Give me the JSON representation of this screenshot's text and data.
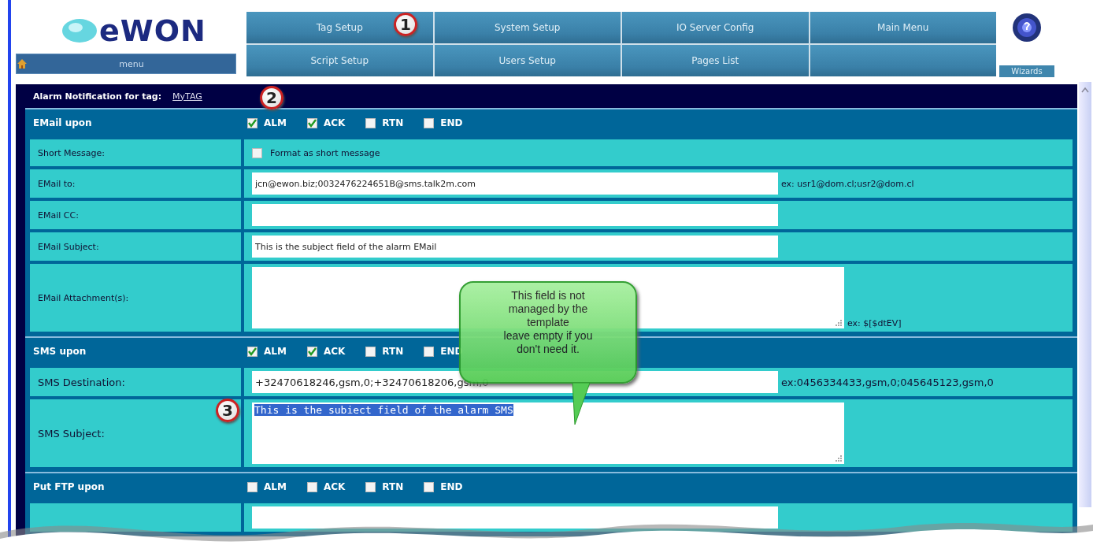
{
  "header": {
    "logo": "eWON",
    "menu_button": "menu",
    "nav": [
      {
        "label": "Tag Setup"
      },
      {
        "label": "System Setup"
      },
      {
        "label": "IO Server Config"
      },
      {
        "label": "Main Menu"
      },
      {
        "label": "Script Setup"
      },
      {
        "label": "Users Setup"
      },
      {
        "label": "Pages List"
      }
    ],
    "wizards": "Wizards"
  },
  "panel": {
    "title": "Alarm Notification for tag:",
    "tag_link": "MyTAG"
  },
  "sections": [
    {
      "title": "EMail upon",
      "options": [
        {
          "label": "ALM",
          "checked": true
        },
        {
          "label": "ACK",
          "checked": true
        },
        {
          "label": "RTN",
          "checked": false
        },
        {
          "label": "END",
          "checked": false
        }
      ],
      "rows": [
        {
          "kind": "checkbox",
          "label": "Short Message:",
          "checked": false,
          "text": "Format as short message"
        },
        {
          "kind": "input",
          "label": "EMail to:",
          "value": "jcn@ewon.biz;0032476224651B@sms.talk2m.com",
          "hint": "ex: usr1@dom.cl;usr2@dom.cl"
        },
        {
          "kind": "input",
          "label": "EMail CC:"
        },
        {
          "kind": "input",
          "label": "EMail Subject:",
          "value": "This is the subject field of the alarm EMail"
        },
        {
          "kind": "textarea",
          "label": "EMail Attachment(s):",
          "hint": "ex: $[$dtEV]"
        }
      ]
    },
    {
      "title": "SMS upon",
      "options": [
        {
          "label": "ALM",
          "checked": true
        },
        {
          "label": "ACK",
          "checked": true
        },
        {
          "label": "RTN",
          "checked": false
        },
        {
          "label": "END",
          "checked": false
        }
      ],
      "rows": [
        {
          "kind": "input",
          "label": "SMS Destination:",
          "value": "+32470618246,gsm,0;+32470618206,gsm,0",
          "hint": "ex:0456334433,gsm,0;045645123,gsm,0"
        },
        {
          "kind": "textarea",
          "label": "SMS Subject:",
          "value": "This is the subiect field of the alarm SMS",
          "selected": true
        }
      ]
    },
    {
      "title": "Put FTP upon",
      "options": [
        {
          "label": "ALM",
          "checked": false
        },
        {
          "label": "ACK",
          "checked": false
        },
        {
          "label": "RTN",
          "checked": false
        },
        {
          "label": "END",
          "checked": false
        }
      ],
      "rows": [
        {
          "kind": "input"
        }
      ]
    }
  ],
  "markers": [
    "1",
    "2",
    "3"
  ],
  "callout": {
    "text": "This field is not\nmanaged by the\ntemplate\nleave empty if you\ndon't need it."
  }
}
